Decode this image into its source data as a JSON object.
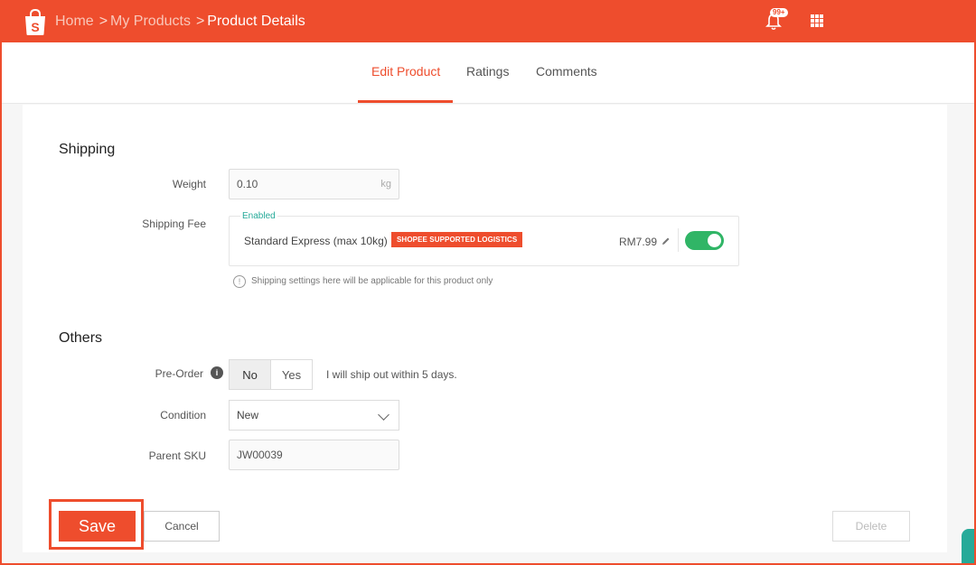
{
  "header": {
    "breadcrumb": [
      "Home",
      "My Products",
      "Product Details"
    ],
    "separator": ">",
    "notification_badge": "99+",
    "brand_color": "#ee4d2d"
  },
  "tabs": [
    {
      "label": "Edit Product",
      "active": true
    },
    {
      "label": "Ratings",
      "active": false
    },
    {
      "label": "Comments",
      "active": false
    }
  ],
  "shipping": {
    "title": "Shipping",
    "weight_label": "Weight",
    "weight_value": "0.10",
    "weight_unit": "kg",
    "fee_label": "Shipping Fee",
    "status": "Enabled",
    "method": "Standard Express (max 10kg)",
    "logistics_badge": "SHOPEE SUPPORTED LOGISTICS",
    "price": "RM7.99",
    "toggle_on": true,
    "note": "Shipping settings here will be applicable for this product only"
  },
  "others": {
    "title": "Others",
    "preorder_label": "Pre-Order",
    "preorder_no": "No",
    "preorder_yes": "Yes",
    "preorder_selected": "No",
    "preorder_note": "I will ship out within 5 days.",
    "condition_label": "Condition",
    "condition_value": "New",
    "sku_label": "Parent SKU",
    "sku_value": "JW00039"
  },
  "actions": {
    "save": "Save",
    "cancel": "Cancel",
    "delete": "Delete"
  },
  "icons": {
    "info": "i",
    "note": "!"
  }
}
